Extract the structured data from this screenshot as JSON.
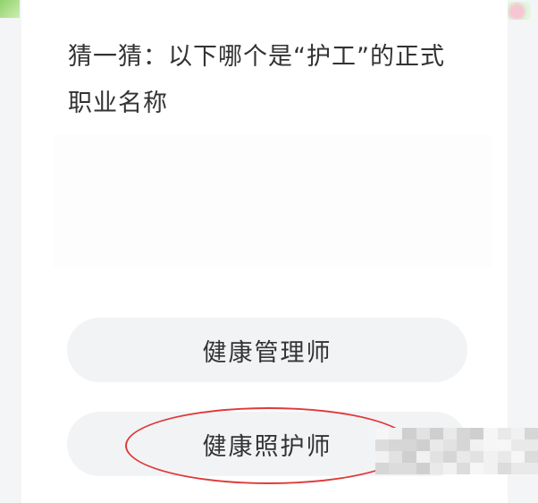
{
  "question": {
    "text": "猜一猜：以下哪个是“护工”的正式职业名称"
  },
  "options": [
    {
      "label": "健康管理师"
    },
    {
      "label": "健康照护师"
    }
  ],
  "highlight": {
    "color": "#e03a3a",
    "selected_option": "健康照护师"
  }
}
